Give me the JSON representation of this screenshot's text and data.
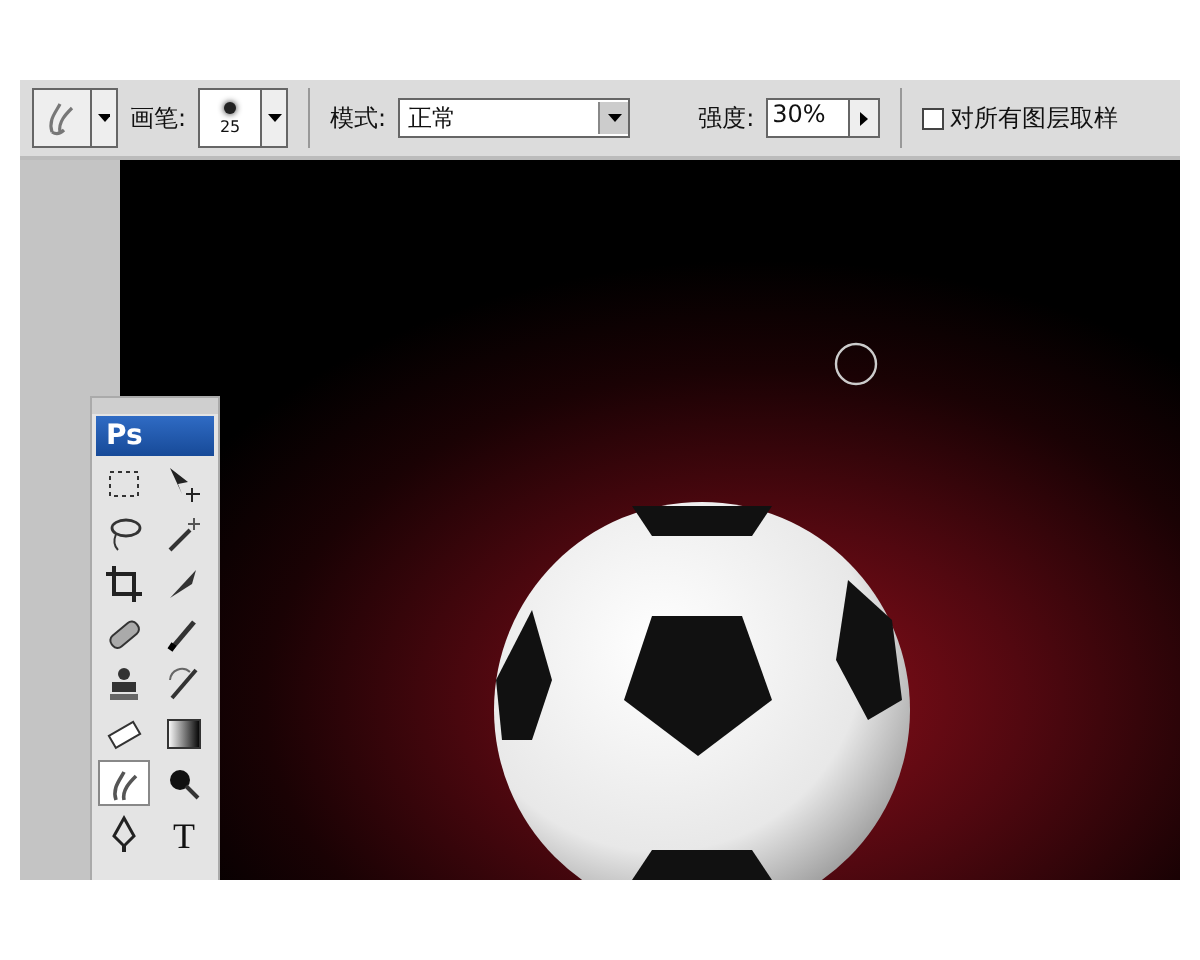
{
  "options_bar": {
    "brush_label": "画笔:",
    "brush_size": "25",
    "mode_label": "模式:",
    "mode_value": "正常",
    "strength_label": "强度:",
    "strength_value": "30%",
    "sample_all_layers": {
      "label": "对所有图层取样",
      "checked": false
    }
  },
  "toolbox": {
    "logo": "Ps",
    "tools": [
      {
        "kind": "marquee",
        "selected": false
      },
      {
        "kind": "move",
        "selected": false
      },
      {
        "kind": "lasso",
        "selected": false
      },
      {
        "kind": "wand",
        "selected": false
      },
      {
        "kind": "crop",
        "selected": false
      },
      {
        "kind": "slice",
        "selected": false
      },
      {
        "kind": "heal",
        "selected": false
      },
      {
        "kind": "brush",
        "selected": false
      },
      {
        "kind": "stamp",
        "selected": false
      },
      {
        "kind": "history",
        "selected": false
      },
      {
        "kind": "eraser",
        "selected": false
      },
      {
        "kind": "gradient",
        "selected": false
      },
      {
        "kind": "smudge",
        "selected": true
      },
      {
        "kind": "dodge",
        "selected": false
      },
      {
        "kind": "pen",
        "selected": false
      },
      {
        "kind": "type",
        "glyph": "T",
        "selected": false
      }
    ]
  }
}
